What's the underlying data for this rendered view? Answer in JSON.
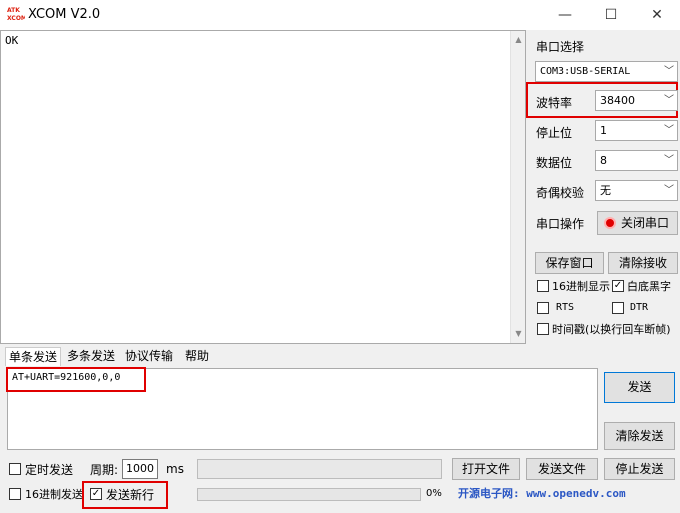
{
  "window": {
    "title": "XCOM V2.0",
    "logo_text": "ATK XCOM"
  },
  "receive": {
    "text": "OK"
  },
  "serial": {
    "port_label": "串口选择",
    "port_value": "COM3:USB-SERIAL",
    "baud_label": "波特率",
    "baud_value": "38400",
    "stop_label": "停止位",
    "stop_value": "1",
    "data_label": "数据位",
    "data_value": "8",
    "parity_label": "奇偶校验",
    "parity_value": "无",
    "op_label": "串口操作",
    "close_button": "关闭串口"
  },
  "buttons": {
    "save_window": "保存窗口",
    "clear_receive": "清除接收",
    "send": "发送",
    "clear_send": "清除发送",
    "open_file": "打开文件",
    "send_file": "发送文件",
    "stop_send": "停止发送"
  },
  "options": {
    "hex_display": "16进制显示",
    "white_black": "白底黑字",
    "rts": "RTS",
    "dtr": "DTR",
    "timestamp": "时间戳(以换行回车断帧)"
  },
  "tabs": [
    "单条发送",
    "多条发送",
    "协议传输",
    "帮助"
  ],
  "send": {
    "text": "AT+UART=921600,0,0"
  },
  "bottom": {
    "timed_send": "定时发送",
    "period_label": "周期:",
    "period_value": "1000",
    "ms": "ms",
    "hex_send": "16进制发送",
    "send_newline": "发送新行",
    "progress": "0%"
  },
  "footer": {
    "text": "开源电子网: www.openedv.com"
  },
  "colors": {
    "highlight": "#e00000",
    "footer": "#2b57c4"
  }
}
